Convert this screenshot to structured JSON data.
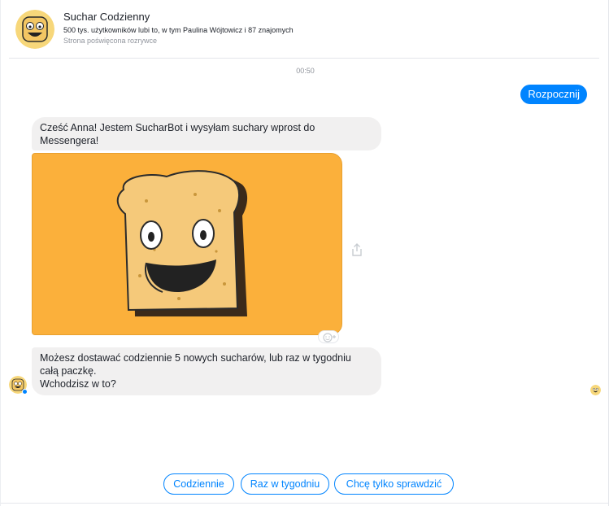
{
  "header": {
    "page_name": "Suchar Codzienny",
    "likes_text": "500 tys. użytkowników lubi to, w tym Paulina Wójtowicz i 87 znajomych",
    "description": "Strona poświęcona rozrywce"
  },
  "conversation": {
    "timestamp": "00:50",
    "outgoing": [
      {
        "text": "Rozpocznij"
      }
    ],
    "incoming": [
      {
        "lines": [
          "Cześć Anna! Jestem SucharBot i wysyłam suchary wprost do",
          "Messengera!"
        ]
      },
      {
        "image": "toast-mascot-image"
      },
      {
        "lines": [
          "Możesz dostawać codziennie 5 nowych sucharów, lub raz w tygodniu",
          "całą paczkę.",
          "Wchodzisz w to?"
        ]
      }
    ]
  },
  "quick_replies": [
    "Codziennie",
    "Raz w tygodniu",
    "Chcę tylko sprawdzić"
  ],
  "icons": {
    "share": "share-icon",
    "reaction": "add-reaction-icon",
    "seen": "seen-avatar-icon"
  },
  "colors": {
    "accent": "#0084ff",
    "bubble_incoming": "#f1f0f0",
    "image_background": "#fbb03b",
    "toast": "#f5c97a"
  }
}
